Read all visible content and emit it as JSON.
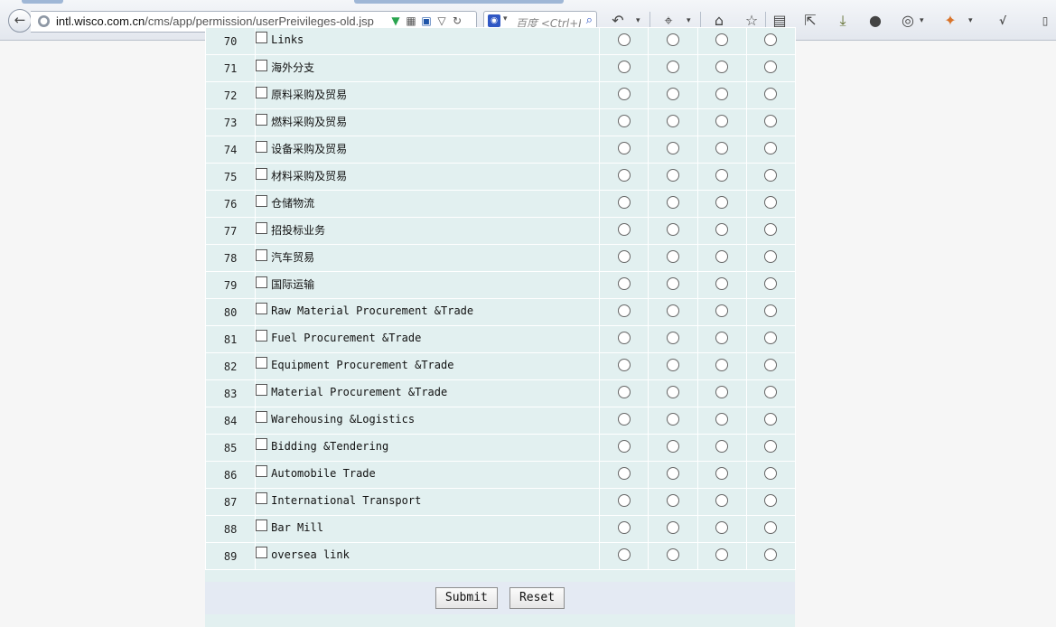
{
  "browser": {
    "url_domain": "intl.wisco.com.cn",
    "url_path": "/cms/app/permission/userPreivileges-old.jsp",
    "search_placeholder": "百度 <Ctrl+K>"
  },
  "rows": [
    {
      "num": "70",
      "name": "Links"
    },
    {
      "num": "71",
      "name": "海外分支"
    },
    {
      "num": "72",
      "name": "原料采购及贸易"
    },
    {
      "num": "73",
      "name": "燃料采购及贸易"
    },
    {
      "num": "74",
      "name": "设备采购及贸易"
    },
    {
      "num": "75",
      "name": "材料采购及贸易"
    },
    {
      "num": "76",
      "name": "仓储物流"
    },
    {
      "num": "77",
      "name": "招投标业务"
    },
    {
      "num": "78",
      "name": "汽车贸易"
    },
    {
      "num": "79",
      "name": "国际运输"
    },
    {
      "num": "80",
      "name": "Raw Material Procurement &Trade"
    },
    {
      "num": "81",
      "name": "Fuel Procurement &Trade"
    },
    {
      "num": "82",
      "name": "Equipment Procurement &Trade"
    },
    {
      "num": "83",
      "name": "Material Procurement &Trade"
    },
    {
      "num": "84",
      "name": "Warehousing &Logistics"
    },
    {
      "num": "85",
      "name": "Bidding &Tendering"
    },
    {
      "num": "86",
      "name": "Automobile Trade"
    },
    {
      "num": "87",
      "name": "International Transport"
    },
    {
      "num": "88",
      "name": "Bar Mill"
    },
    {
      "num": "89",
      "name": "oversea link"
    }
  ],
  "buttons": {
    "submit": "Submit",
    "reset": "Reset"
  }
}
